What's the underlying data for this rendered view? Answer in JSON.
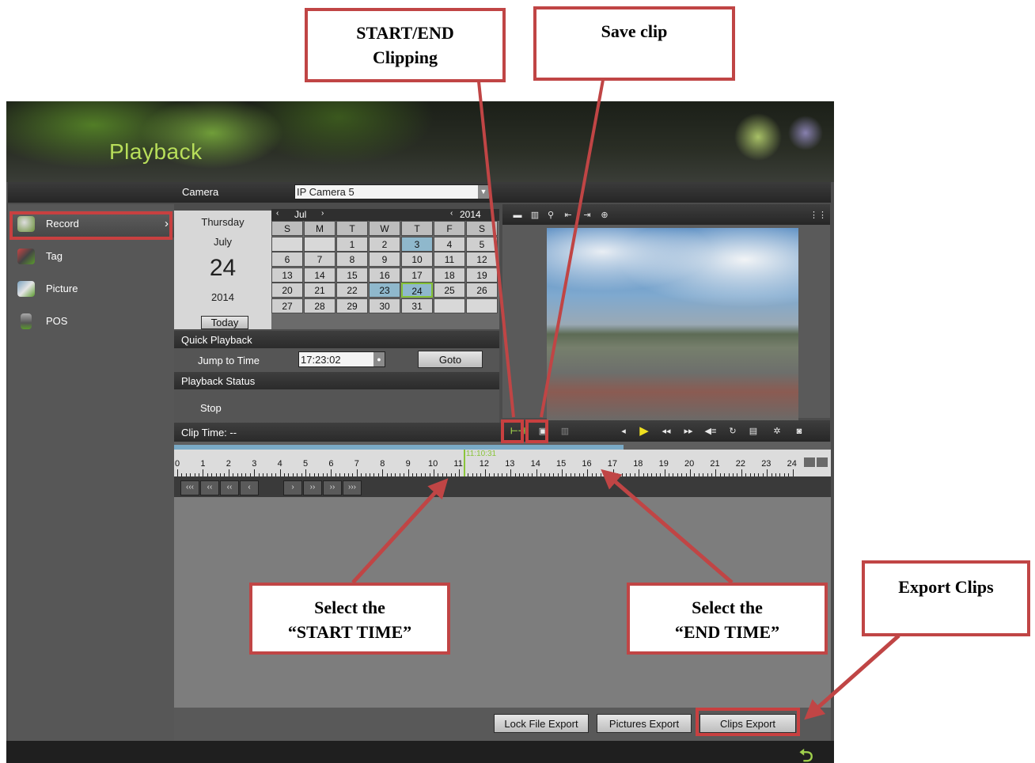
{
  "app": {
    "title": "Playback",
    "camera_label": "Camera",
    "camera_value": "IP Camera 5"
  },
  "sidebar": {
    "items": [
      {
        "label": "Record",
        "icon": "record-icon",
        "chevron": "›"
      },
      {
        "label": "Tag",
        "icon": "tag-icon"
      },
      {
        "label": "Picture",
        "icon": "picture-icon"
      },
      {
        "label": "POS",
        "icon": "pos-icon"
      }
    ]
  },
  "calendar": {
    "weekday": "Thursday",
    "month": "July",
    "day": "24",
    "year": "2014",
    "nav_month": "Jul",
    "nav_year": "2014",
    "today_label": "Today",
    "headers": [
      "S",
      "M",
      "T",
      "W",
      "T",
      "F",
      "S"
    ],
    "weeks": [
      [
        "",
        "",
        "1",
        "2",
        "3",
        "4",
        "5"
      ],
      [
        "6",
        "7",
        "8",
        "9",
        "10",
        "11",
        "12"
      ],
      [
        "13",
        "14",
        "15",
        "16",
        "17",
        "18",
        "19"
      ],
      [
        "20",
        "21",
        "22",
        "23",
        "24",
        "25",
        "26"
      ],
      [
        "27",
        "28",
        "29",
        "30",
        "31",
        "",
        ""
      ]
    ],
    "recorded_days": [
      "3",
      "23"
    ],
    "selected_day": "24"
  },
  "quick_playback": {
    "section_label": "Quick Playback",
    "jump_label": "Jump to Time",
    "time_value": "17:23:02",
    "goto_label": "Goto"
  },
  "playback_status": {
    "section_label": "Playback Status",
    "value": "Stop"
  },
  "clip_time": {
    "label": "Clip Time: --"
  },
  "timeline": {
    "hours": [
      "0",
      "1",
      "2",
      "3",
      "4",
      "5",
      "6",
      "7",
      "8",
      "9",
      "10",
      "11",
      "12",
      "13",
      "14",
      "15",
      "16",
      "17",
      "18",
      "19",
      "20",
      "21",
      "22",
      "23",
      "24"
    ],
    "cursor_time": "11:10:31",
    "cursor_hour": 11.17,
    "recorded_until_hour": 17.4,
    "speed_buttons_left": [
      "‹‹‹",
      "‹‹",
      "‹‹",
      "‹"
    ],
    "speed_buttons_right": [
      "›",
      "››",
      "››",
      "›››"
    ]
  },
  "footer": {
    "lock_export": "Lock File Export",
    "pictures_export": "Pictures Export",
    "clips_export": "Clips Export"
  },
  "annotations": {
    "start_end_clipping": "START/END\nClipping",
    "save_clip": "Save clip",
    "select_start": "Select the\n“START TIME”",
    "select_end": "Select the\n“END TIME”",
    "export_clips": "Export Clips"
  },
  "colors": {
    "accent_green": "#b8de5a",
    "callout_red": "#c04545",
    "record_blue": "#8fb8cc"
  }
}
